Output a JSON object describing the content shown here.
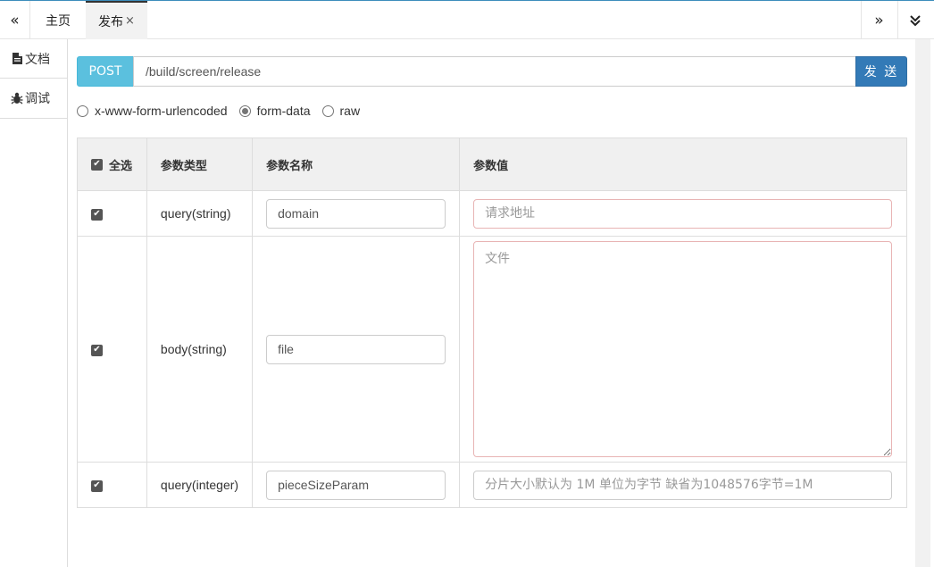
{
  "tabs": {
    "home": "主页",
    "active": "发布",
    "close_glyph": "×"
  },
  "sidebar": {
    "doc": "文档",
    "debug": "调试"
  },
  "request": {
    "method": "POST",
    "url": "/build/screen/release",
    "send_label": "发 送"
  },
  "body_types": [
    {
      "label": "x-www-form-urlencoded",
      "checked": false
    },
    {
      "label": "form-data",
      "checked": true
    },
    {
      "label": "raw",
      "checked": false
    }
  ],
  "table": {
    "headers": {
      "select_all": "全选",
      "type": "参数类型",
      "name": "参数名称",
      "value": "参数值"
    },
    "rows": [
      {
        "checked": true,
        "type": "query(string)",
        "name": "domain",
        "value_placeholder": "请求地址"
      },
      {
        "checked": true,
        "type": "body(string)",
        "name": "file",
        "value_placeholder": "文件"
      },
      {
        "checked": true,
        "type": "query(integer)",
        "name": "pieceSizeParam",
        "value_placeholder": "分片大小默认为 1M 单位为字节 缺省为1048576字节=1M"
      }
    ]
  },
  "icons": {
    "prev": "double-chevron-left-icon",
    "next": "double-chevron-right-icon",
    "menu": "double-chevron-down-icon",
    "doc": "file-icon",
    "debug": "bug-icon"
  }
}
